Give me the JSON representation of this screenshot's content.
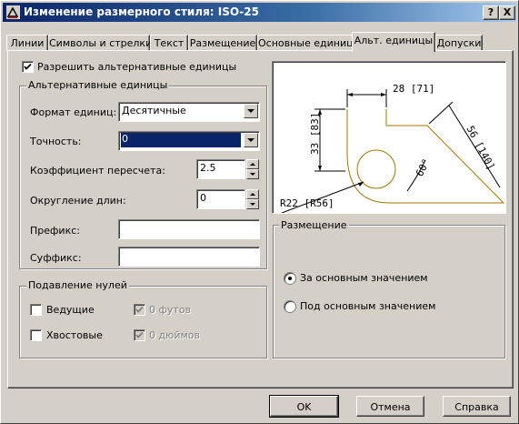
{
  "window": {
    "title": "Изменение размерного стиля: ISO-25",
    "help_btn": "?",
    "close_btn": "X"
  },
  "tabs": [
    {
      "label": "Линии"
    },
    {
      "label": "Символы и стрелки"
    },
    {
      "label": "Текст"
    },
    {
      "label": "Размещение"
    },
    {
      "label": "Основные единицы"
    },
    {
      "label": "Альт. единицы"
    },
    {
      "label": "Допуски"
    }
  ],
  "enable_alt": {
    "label": "Разрешить альтернативные единицы",
    "checked": true
  },
  "alt_units": {
    "group_label": "Альтернативные единицы",
    "format_label": "Формат единиц:",
    "format_value": "Десятичные",
    "precision_label": "Точность:",
    "precision_value": "0",
    "scale_label": "Коэффициент пересчета:",
    "scale_value": "2.5",
    "round_label": "Округление длин:",
    "round_value": "0",
    "prefix_label": "Префикс:",
    "prefix_value": "",
    "suffix_label": "Суффикс:",
    "suffix_value": ""
  },
  "zero_suppress": {
    "group_label": "Подавление нулей",
    "leading": "Ведущие",
    "trailing": "Хвостовые",
    "feet": "0 футов",
    "inches": "0 дюймов"
  },
  "preview": {
    "dim_top": "28 [71]",
    "dim_left": "33 [83]",
    "dim_right": "56 [140]",
    "dim_angle": "60°",
    "dim_radius": "R22 [R56]"
  },
  "placement": {
    "group_label": "Размещение",
    "after": "За основным значением",
    "below": "Под основным значением",
    "selected": "after"
  },
  "buttons": {
    "ok": "OK",
    "cancel": "Отмена",
    "help": "Справка"
  },
  "colors": {
    "title_start": "#0a246a",
    "title_end": "#a6caf0",
    "selection": "#0a246a",
    "preview_lines": "#a07800"
  }
}
